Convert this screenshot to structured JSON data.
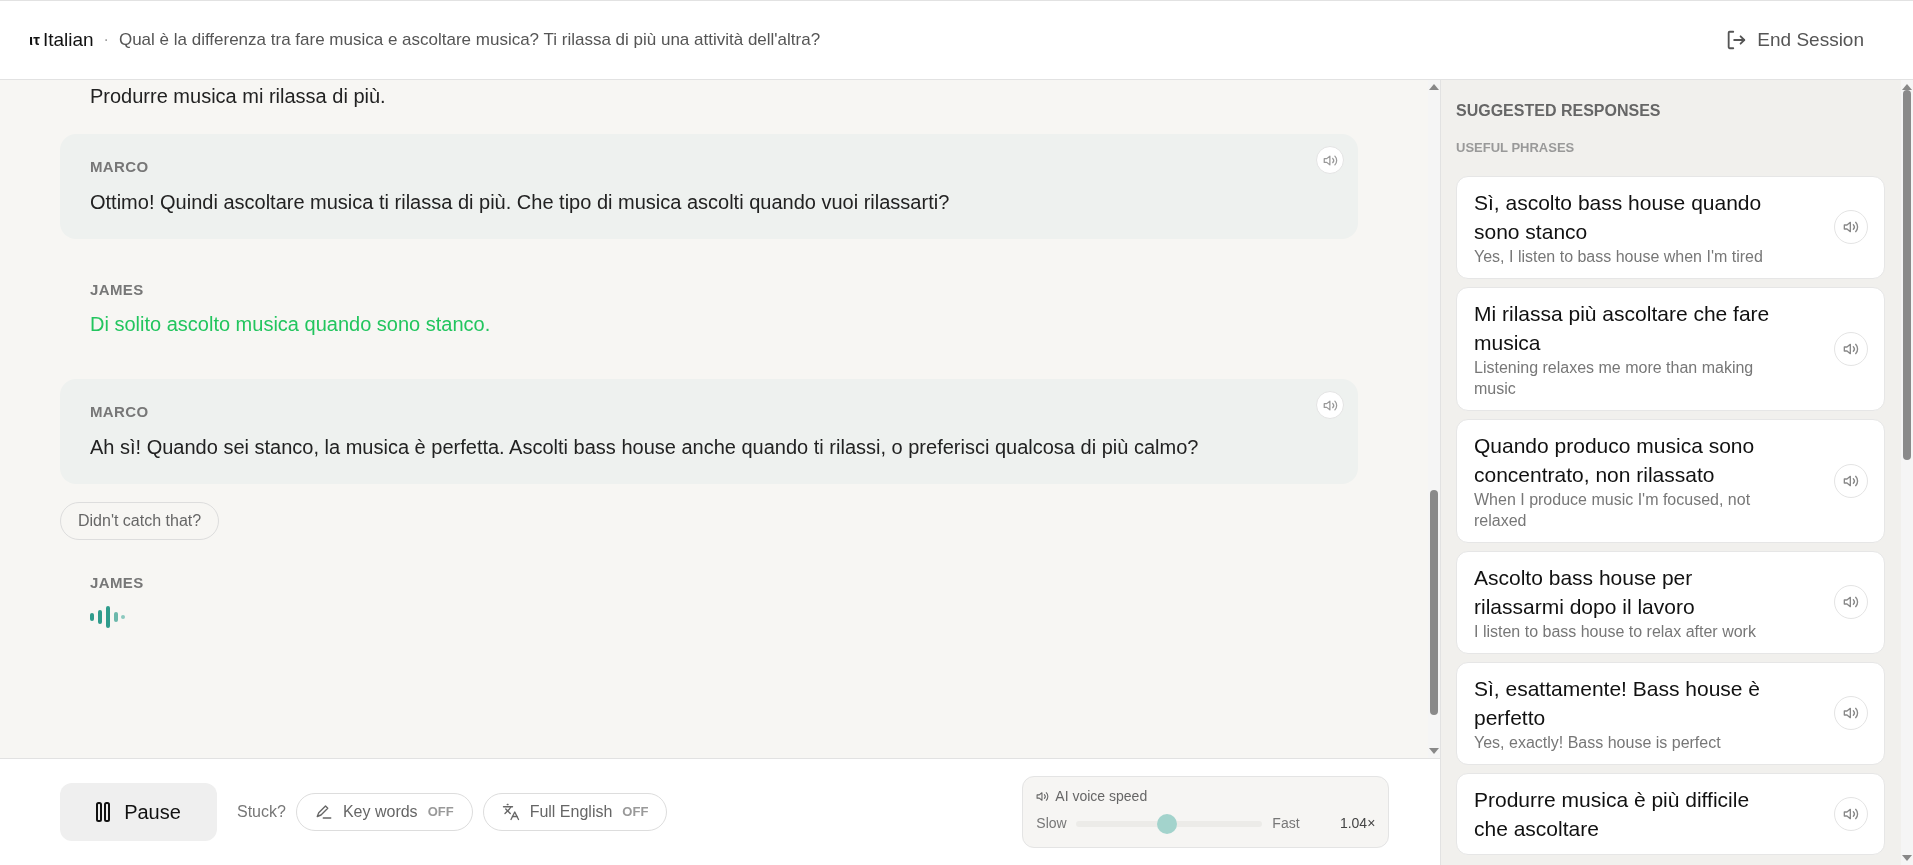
{
  "header": {
    "language_mark": "ιτ",
    "language": "Italian",
    "separator": "·",
    "topic": "Qual è la differenza tra fare musica e ascoltare musica? Ti rilassa di più una attività dell'altra?",
    "end_session": "End Session"
  },
  "chat": {
    "cut_text": "Produrre musica mi rilassa di più.",
    "messages": [
      {
        "kind": "ai",
        "speaker": "MARCO",
        "text": "Ottimo! Quindi ascoltare musica ti rilassa di più. Che tipo di musica ascolti quando vuoi rilassarti?"
      },
      {
        "kind": "user",
        "speaker": "JAMES",
        "text": "Di solito ascolto musica quando sono stanco."
      },
      {
        "kind": "ai",
        "speaker": "MARCO",
        "text": "Ah sì! Quando sei stanco, la musica è perfetta. Ascolti bass house anche quando ti rilassi, o preferisci qualcosa di più calmo?"
      },
      {
        "kind": "retry",
        "text": "Didn't catch that?"
      },
      {
        "kind": "listening",
        "speaker": "JAMES"
      }
    ]
  },
  "controls": {
    "pause": "Pause",
    "stuck": "Stuck?",
    "toggles": [
      {
        "kind": "keywords",
        "label": "Key words",
        "status": "OFF",
        "on": false
      },
      {
        "kind": "translate",
        "label": "Full English",
        "status": "OFF",
        "on": false
      }
    ],
    "voice_speed": {
      "title": "AI voice speed",
      "slow": "Slow",
      "fast": "Fast",
      "level": 0.49,
      "reading": "1.04×"
    }
  },
  "suggestions": {
    "title": "SUGGESTED RESPONSES",
    "subtitle": "USEFUL PHRASES",
    "items": [
      {
        "phrase": "Sì, ascolto bass house quando sono stanco",
        "translation": "Yes, I listen to bass house when I'm tired"
      },
      {
        "phrase": "Mi rilassa più ascoltare che fare musica",
        "translation": "Listening relaxes me more than making music"
      },
      {
        "phrase": "Quando produco musica sono concentrato, non rilassato",
        "translation": "When I produce music I'm focused, not relaxed"
      },
      {
        "phrase": "Ascolto bass house per rilassarmi dopo il lavoro",
        "translation": "I listen to bass house to relax after work"
      },
      {
        "phrase": "Sì, esattamente! Bass house è perfetto",
        "translation": "Yes, exactly! Bass house is perfect"
      },
      {
        "phrase": "Produrre musica è più difficile che ascoltare"
      }
    ]
  }
}
